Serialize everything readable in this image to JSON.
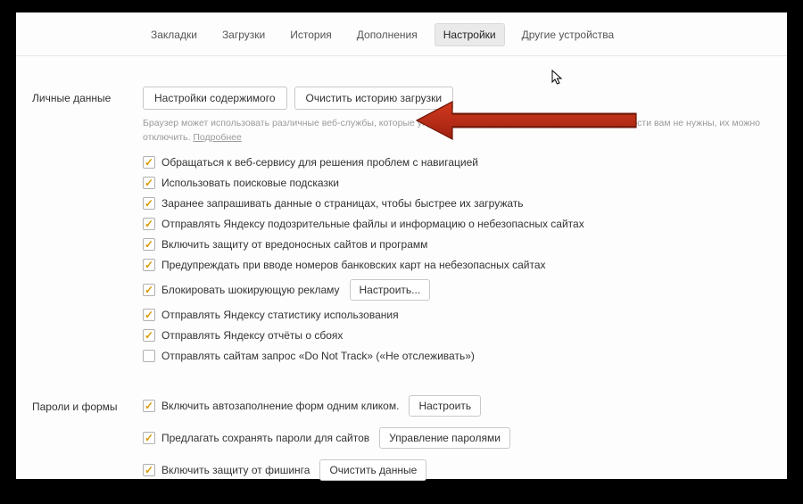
{
  "tabs": {
    "bookmarks": "Закладки",
    "downloads": "Загрузки",
    "history": "История",
    "addons": "Дополнения",
    "settings": "Настройки",
    "other_devices": "Другие устройства"
  },
  "personal": {
    "section_label": "Личные данные",
    "content_settings_btn": "Настройки содержимого",
    "clear_history_btn": "Очистить историю загрузки",
    "hint_text": "Браузер может использовать различные веб-службы, которые упрощают работу в интернете. Если эти возможности вам не нужны, их можно отключить. ",
    "hint_link": "Подробнее",
    "items": [
      {
        "label": "Обращаться к веб-сервису для решения проблем с навигацией",
        "checked": true
      },
      {
        "label": "Использовать поисковые подсказки",
        "checked": true
      },
      {
        "label": "Заранее запрашивать данные о страницах, чтобы быстрее их загружать",
        "checked": true
      },
      {
        "label": "Отправлять Яндексу подозрительные файлы и информацию о небезопасных сайтах",
        "checked": true
      },
      {
        "label": "Включить защиту от вредоносных сайтов и программ",
        "checked": true
      },
      {
        "label": "Предупреждать при вводе номеров банковских карт на небезопасных сайтах",
        "checked": true
      },
      {
        "label": "Блокировать шокирующую рекламу",
        "checked": true,
        "btn": "Настроить..."
      },
      {
        "label": "Отправлять Яндексу статистику использования",
        "checked": true
      },
      {
        "label": "Отправлять Яндексу отчёты о сбоях",
        "checked": true
      },
      {
        "label": "Отправлять сайтам запрос «Do Not Track» («Не отслеживать»)",
        "checked": false
      }
    ]
  },
  "passwords": {
    "section_label": "Пароли и формы",
    "items": [
      {
        "label": "Включить автозаполнение форм одним кликом.",
        "checked": true,
        "btn": "Настроить"
      },
      {
        "label": "Предлагать сохранять пароли для сайтов",
        "checked": true,
        "btn": "Управление паролями"
      },
      {
        "label": "Включить защиту от фишинга",
        "checked": true,
        "btn": "Очистить данные"
      }
    ]
  }
}
